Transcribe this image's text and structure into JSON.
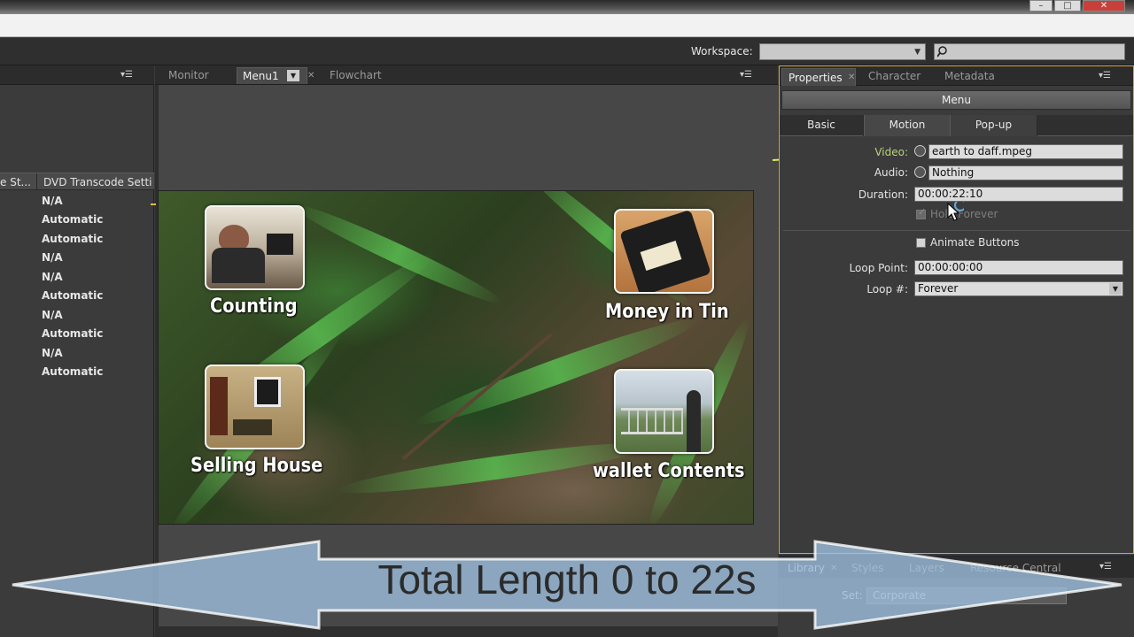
{
  "window": {
    "controls": [
      "–",
      "□",
      "✕"
    ]
  },
  "toolbar": {
    "workspace_label": "Workspace:",
    "workspace_value": "",
    "search_placeholder": ""
  },
  "left_panel": {
    "columns": [
      "e St...",
      "DVD Transcode Setti"
    ],
    "rows": [
      "N/A",
      "Automatic",
      "Automatic",
      "N/A",
      "N/A",
      "Automatic",
      "N/A",
      "Automatic",
      "N/A",
      "Automatic"
    ]
  },
  "center_panel": {
    "tabs": {
      "monitor": "Monitor",
      "menu1": "Menu1",
      "flowchart": "Flowchart"
    },
    "menu_buttons": {
      "counting": "Counting",
      "money_in_tin": "Money in Tin",
      "selling_house": "Selling House",
      "wallet_contents": "wallet Contents"
    }
  },
  "properties_panel": {
    "tabs": {
      "properties": "Properties",
      "character": "Character",
      "metadata": "Metadata"
    },
    "title": "Menu",
    "subtabs": {
      "basic": "Basic",
      "motion": "Motion",
      "popup": "Pop-up"
    },
    "video_label": "Video:",
    "video_value": "earth to daff.mpeg",
    "audio_label": "Audio:",
    "audio_value": "Nothing",
    "duration_label": "Duration:",
    "duration_value": "00:00:22:10",
    "hold_forever_label": "Hold Forever",
    "animate_buttons_label": "Animate Buttons",
    "loop_point_label": "Loop Point:",
    "loop_point_value": "00:00:00:00",
    "loop_count_label": "Loop #:",
    "loop_count_value": "Forever"
  },
  "library_panel": {
    "tabs": {
      "library": "Library",
      "styles": "Styles",
      "layers": "Layers",
      "resource_central": "Resource Central"
    },
    "set_label": "Set:",
    "set_value": "Corporate"
  },
  "overlay": {
    "text": "Total Length 0 to 22s",
    "color": "#9fc1e0"
  },
  "colors": {
    "panel_focus": "#e0a72a",
    "timeline_line": "#d6f06a"
  }
}
